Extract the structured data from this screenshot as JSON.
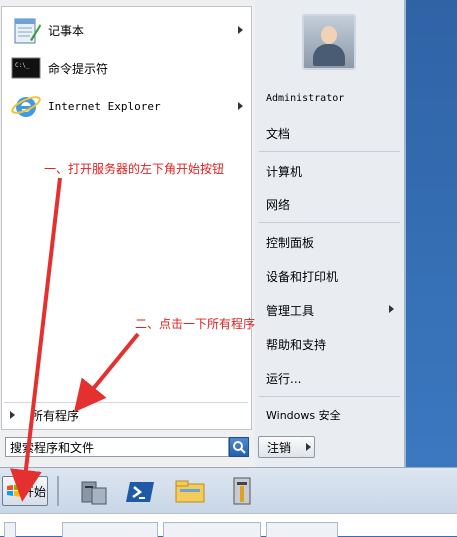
{
  "start_menu": {
    "pinned": [
      {
        "label": "记事本",
        "icon": "notepad-icon",
        "has_submenu": true
      },
      {
        "label": "命令提示符",
        "icon": "cmd-icon",
        "has_submenu": false
      },
      {
        "label": "Internet Explorer",
        "icon": "ie-icon",
        "has_submenu": true
      }
    ],
    "all_programs": "所有程序",
    "search": {
      "value": "搜索程序和文件"
    },
    "right": {
      "user": "Administrator",
      "items": [
        {
          "label": "文档"
        },
        {
          "label": "计算机"
        },
        {
          "label": "网络"
        },
        {
          "label": "控制面板"
        },
        {
          "label": "设备和打印机"
        },
        {
          "label": "管理工具",
          "has_submenu": true
        },
        {
          "label": "帮助和支持"
        },
        {
          "label": "运行..."
        },
        {
          "label": "Windows 安全"
        }
      ],
      "logoff": "注销"
    }
  },
  "taskbar": {
    "start_label": "开始",
    "icons": [
      "server-manager-icon",
      "powershell-icon",
      "explorer-folder-icon",
      "admin-tools-icon"
    ]
  },
  "annotations": {
    "step1": "一、打开服务器的左下角开始按钮",
    "step2": "二、点击一下所有程序"
  },
  "colors": {
    "annotation": "#e02020"
  }
}
